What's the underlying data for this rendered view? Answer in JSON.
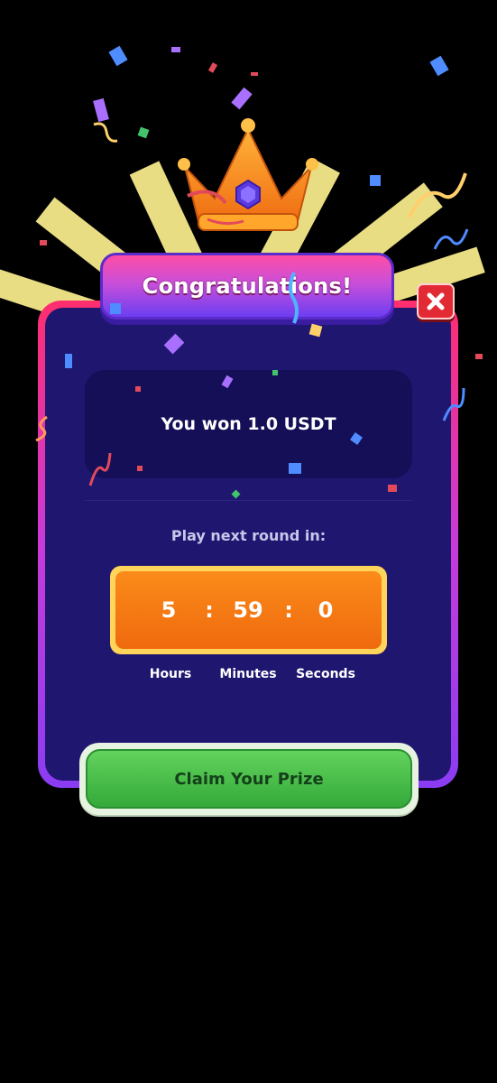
{
  "dialog": {
    "title": "Congratulations!",
    "prize_text": "You won 1.0 USDT",
    "next_round_label": "Play next round in:",
    "timer": {
      "hours": "5",
      "minutes": "59",
      "seconds": "0",
      "separator": ":",
      "hours_label": "Hours",
      "minutes_label": "Minutes",
      "seconds_label": "Seconds"
    },
    "claim_button_label": "Claim Your Prize",
    "close_icon": "close-icon"
  },
  "colors": {
    "background": "#000000",
    "panel": "#1f1670",
    "timer": "#ef6a0e",
    "claim_button": "#34a93a",
    "close_button": "#e22a34"
  }
}
